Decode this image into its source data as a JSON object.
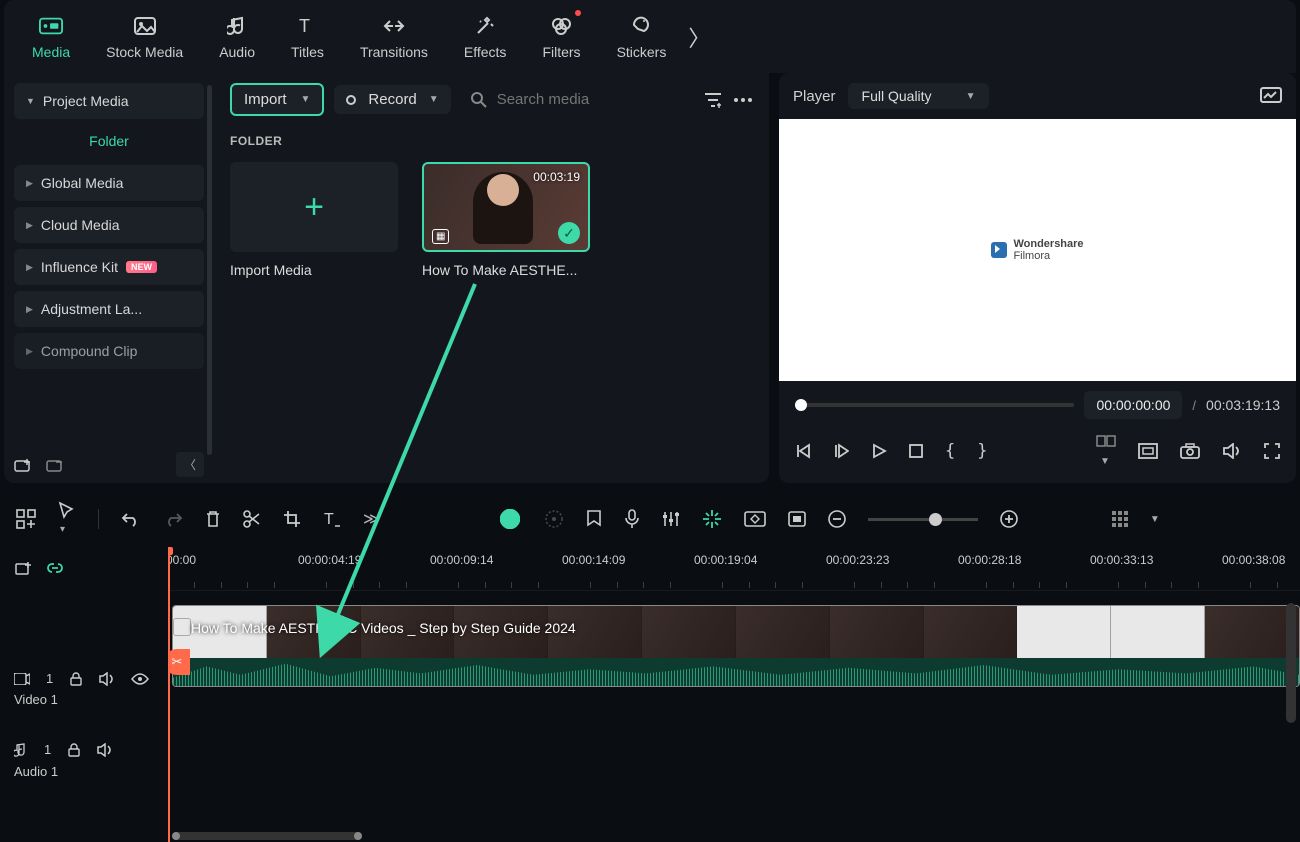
{
  "topnav": {
    "items": [
      {
        "label": "Media",
        "icon": "media"
      },
      {
        "label": "Stock Media",
        "icon": "stock"
      },
      {
        "label": "Audio",
        "icon": "audio"
      },
      {
        "label": "Titles",
        "icon": "titles"
      },
      {
        "label": "Transitions",
        "icon": "transitions"
      },
      {
        "label": "Effects",
        "icon": "effects"
      },
      {
        "label": "Filters",
        "icon": "filters",
        "badge": true
      },
      {
        "label": "Stickers",
        "icon": "stickers"
      }
    ]
  },
  "sidebar": {
    "project_media": "Project Media",
    "folder": "Folder",
    "items": [
      {
        "label": "Global Media"
      },
      {
        "label": "Cloud Media"
      },
      {
        "label": "Influence Kit",
        "new": "NEW"
      },
      {
        "label": "Adjustment La..."
      },
      {
        "label": "Compound Clip"
      }
    ]
  },
  "media": {
    "import": "Import",
    "record": "Record",
    "search_placeholder": "Search media",
    "section": "FOLDER",
    "cards": [
      {
        "caption": "Import Media"
      },
      {
        "caption": "How To Make AESTHE...",
        "duration": "00:03:19"
      }
    ]
  },
  "player": {
    "title": "Player",
    "quality": "Full Quality",
    "logo_brand": "Wondershare",
    "logo_product": "Filmora",
    "pos": "00:00:00:00",
    "sep": "/",
    "dur": "00:03:19:13"
  },
  "ruler": {
    "ticks": [
      "00:00",
      "00:00:04:19",
      "00:00:09:14",
      "00:00:14:09",
      "00:00:19:04",
      "00:00:23:23",
      "00:00:28:18",
      "00:00:33:13",
      "00:00:38:08"
    ]
  },
  "tracks": {
    "video": {
      "name": "Video 1",
      "index": "1"
    },
    "audio": {
      "name": "Audio 1",
      "index": "1"
    }
  },
  "clip": {
    "title": "How To Make AESTHETIC Videos _ Step by Step Guide 2024"
  }
}
